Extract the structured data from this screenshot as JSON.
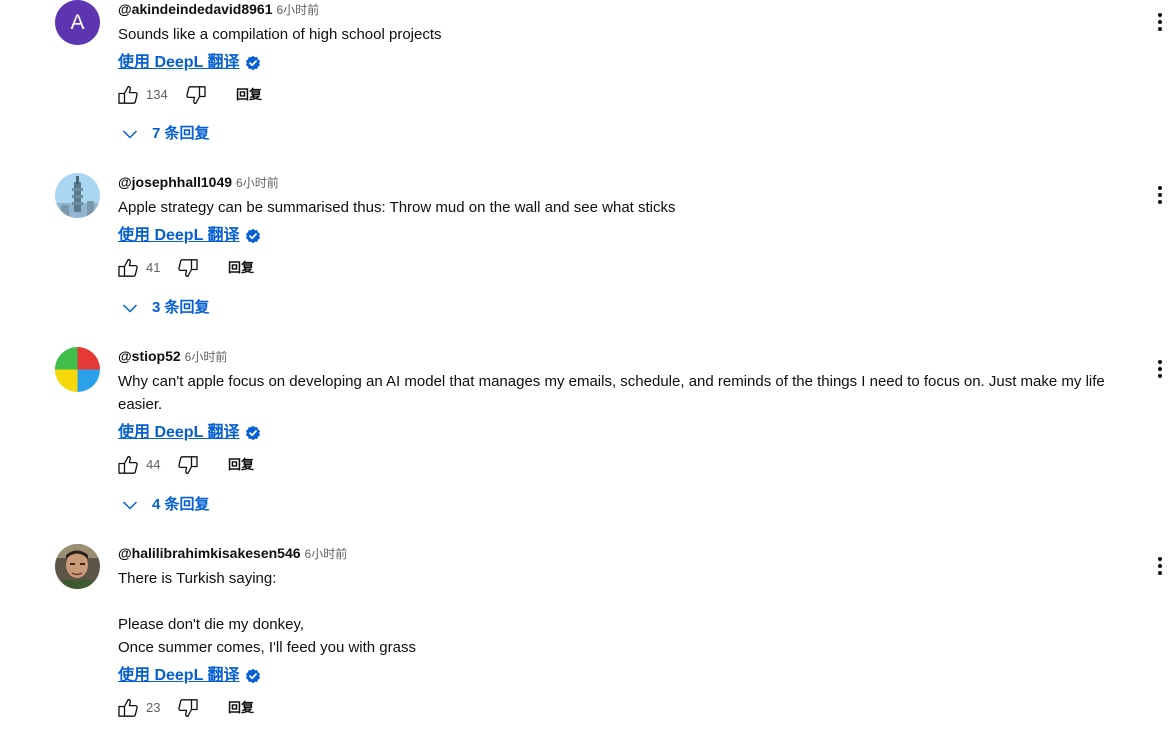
{
  "comments": [
    {
      "author": "@akindeindedavid8961",
      "time": "6小时前",
      "text": "Sounds like a compilation of high school projects",
      "translate_label": "使用 DeepL 翻译",
      "likes": "134",
      "reply_label": "回复",
      "replies_label": "7 条回复",
      "avatar_letter": "A"
    },
    {
      "author": "@josephhall1049",
      "time": "6小时前",
      "text": "Apple strategy can be summarised thus: Throw mud on the wall and see what sticks",
      "translate_label": "使用 DeepL 翻译",
      "likes": "41",
      "reply_label": "回复",
      "replies_label": "3 条回复"
    },
    {
      "author": "@stiop52",
      "time": "6小时前",
      "text": "Why can't apple focus on developing an AI model that manages my emails, schedule, and reminds of the things I need to focus on. Just make my life easier.",
      "translate_label": "使用 DeepL 翻译",
      "likes": "44",
      "reply_label": "回复",
      "replies_label": "4 条回复"
    },
    {
      "author": "@halilibrahimkisakesen546",
      "time": "6小时前",
      "text": "There is Turkish saying:\n\nPlease don't die my donkey,\nOnce summer comes, I'll feed you with grass",
      "translate_label": "使用 DeepL 翻译",
      "likes": "23",
      "reply_label": "回复"
    }
  ],
  "icons": {
    "like": "thumbs-up-icon",
    "dislike": "thumbs-down-icon",
    "more": "more-vert-icon",
    "expand": "chevron-down-icon",
    "verified": "verified-badge-icon"
  },
  "colors": {
    "link": "#065fd4",
    "text": "#0f0f0f",
    "muted": "#606060",
    "avatar_purple": "#5e35b1"
  }
}
